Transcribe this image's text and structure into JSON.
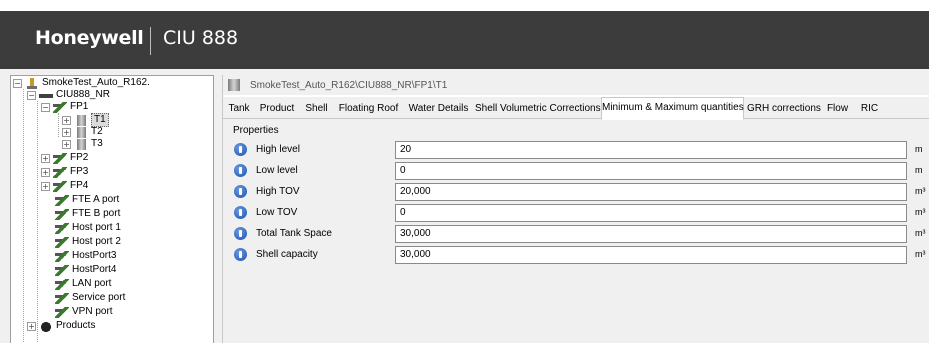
{
  "header": {
    "brand": "Honeywell",
    "product": "CIU 888",
    "background": "#3c3c3c"
  },
  "tree": {
    "root": "SmokeTest_Auto_R162.",
    "ciu": "CIU888_NR",
    "fp1": "FP1",
    "tanks": [
      "T1",
      "T2",
      "T3"
    ],
    "selected": "T1",
    "fp_nodes": [
      "FP2",
      "FP3",
      "FP4"
    ],
    "ports": [
      "FTE A port",
      "FTE B port",
      "Host port 1",
      "Host port 2",
      "HostPort3",
      "HostPort4",
      "LAN port",
      "Service port",
      "VPN port"
    ],
    "products": "Products"
  },
  "path": "SmokeTest_Auto_R162\\CIU888_NR\\FP1\\T1",
  "tabs": [
    "Tank",
    "Product",
    "Shell",
    "Floating Roof",
    "Water Details",
    "Shell Volumetric Corrections",
    "Minimum & Maximum quantities",
    "GRH corrections",
    "Flow",
    "RIC"
  ],
  "active_tab": "Minimum & Maximum quantities",
  "properties": {
    "heading": "Properties",
    "rows": [
      {
        "label": "High level",
        "value": "20",
        "unit": "m"
      },
      {
        "label": "Low level",
        "value": "0",
        "unit": "m"
      },
      {
        "label": "High TOV",
        "value": "20,000",
        "unit": "m³"
      },
      {
        "label": "Low TOV",
        "value": "0",
        "unit": "m³"
      },
      {
        "label": "Total Tank Space",
        "value": "30,000",
        "unit": "m³"
      },
      {
        "label": "Shell capacity",
        "value": "30,000",
        "unit": "m³"
      }
    ]
  }
}
